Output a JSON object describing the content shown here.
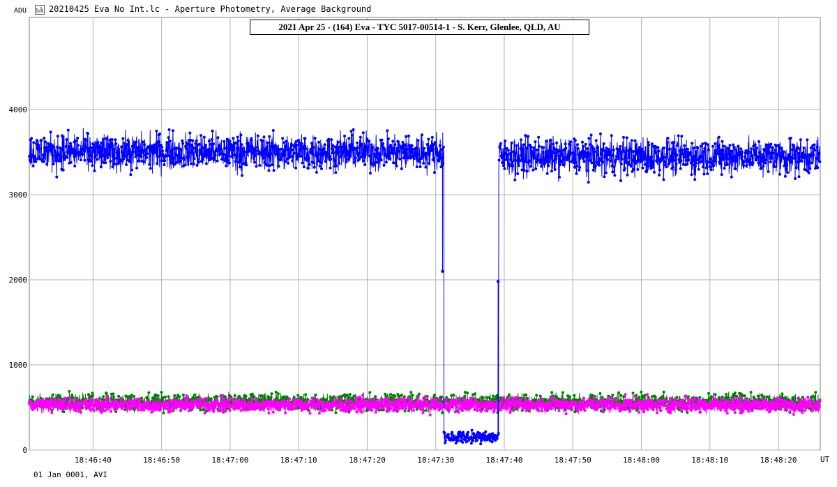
{
  "window": {
    "title": "20210425 Eva No Int.lc - Aperture Photometry, Average Background",
    "icon": "lightcurve-chart-icon"
  },
  "footer": {
    "date_label": "01 Jan 0001, AVI"
  },
  "chart_data": {
    "type": "line",
    "title": "2021 Apr 25 - (164) Eva - TYC 5017-00514-1 - S. Kerr, Glenlee, QLD, AU",
    "xlabel": "UT",
    "ylabel": "ADU",
    "x_unit": "seconds after 18:46:00 UT",
    "xlim": [
      30.7,
      146.1
    ],
    "ylim": [
      0,
      4000
    ],
    "grid": true,
    "x_tick_labels": [
      "18:46:40",
      "18:46:50",
      "18:47:00",
      "18:47:10",
      "18:47:20",
      "18:47:30",
      "18:47:40",
      "18:47:50",
      "18:48:00",
      "18:48:10",
      "18:48:20"
    ],
    "y_tick_labels": [
      "0",
      "1000",
      "2000",
      "3000",
      "4000"
    ],
    "series": [
      {
        "name": "",
        "color": "#0000ff",
        "description": "target star - occultation dip",
        "segments": [
          {
            "x_start": 30.7,
            "x_end": 91.2,
            "mean": 3500,
            "spread": 200
          },
          {
            "x_start": 91.2,
            "x_end": 99.2,
            "mean": 150,
            "spread": 60
          },
          {
            "x_start": 99.2,
            "x_end": 146.1,
            "mean": 3450,
            "spread": 200
          }
        ],
        "transition_points": [
          [
            91.0,
            2100
          ],
          [
            99.1,
            1980
          ]
        ]
      },
      {
        "name": "",
        "color": "#008000",
        "description": "background aperture",
        "mean": 560,
        "spread": 90
      },
      {
        "name": "",
        "color": "#ff00ff",
        "description": "background aperture",
        "mean": 530,
        "spread": 80
      }
    ]
  }
}
